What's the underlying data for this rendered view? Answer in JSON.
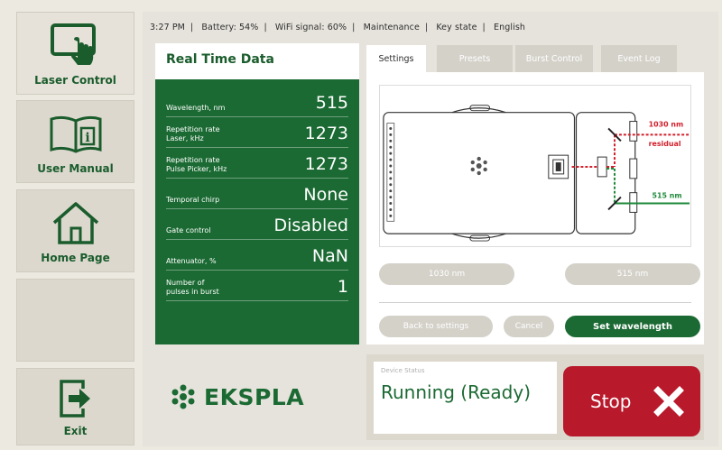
{
  "sidebar": {
    "items": [
      {
        "label": "Laser Control",
        "icon": "touchscreen-icon",
        "active": true
      },
      {
        "label": "User Manual",
        "icon": "book-info-icon",
        "active": false
      },
      {
        "label": "Home Page",
        "icon": "home-icon",
        "active": false
      },
      {
        "label": "",
        "icon": "",
        "active": false
      },
      {
        "label": "Exit",
        "icon": "exit-icon",
        "active": false
      }
    ]
  },
  "statusbar": {
    "time": "3:27 PM",
    "battery": "Battery:   54%",
    "wifi": "WiFi signal:    60%",
    "maintenance": "Maintenance",
    "key_state": "Key state",
    "language": "English"
  },
  "realtime": {
    "title": "Real Time Data",
    "rows": [
      {
        "name": "Wavelength, nm",
        "value": "515"
      },
      {
        "name": "Repetition rate\nLaser, kHz",
        "value": "1273"
      },
      {
        "name": "Repetition rate\nPulse Picker, kHz",
        "value": "1273"
      },
      {
        "name": "Temporal chirp",
        "value": "None"
      },
      {
        "name": "Gate control",
        "value": "Disabled"
      },
      {
        "name": "Attenuator, %",
        "value": "NaN"
      },
      {
        "name": "Number of\npulses in burst",
        "value": "1"
      }
    ]
  },
  "tabs": [
    {
      "label": "Settings",
      "active": true
    },
    {
      "label": "Presets",
      "active": false
    },
    {
      "label": "Burst Control",
      "active": false
    },
    {
      "label": "Event Log",
      "active": false
    }
  ],
  "settings": {
    "diagram_label_1030_a": "1030 nm",
    "diagram_label_1030_b": "residual",
    "diagram_label_515": "515 nm",
    "btn_1030": "1030 nm",
    "btn_515": "515 nm",
    "btn_back": "Back to settings",
    "btn_cancel": "Cancel",
    "btn_set": "Set wavelength"
  },
  "brand": {
    "name": "EKSPLA"
  },
  "device": {
    "caption": "Device Status",
    "state": "Running (Ready)",
    "stop_label": "Stop"
  },
  "colors": {
    "brand_green": "#1b6a33",
    "stop_red": "#b8192b",
    "beam_red": "#d21f2b",
    "beam_green": "#1f8a3a"
  }
}
